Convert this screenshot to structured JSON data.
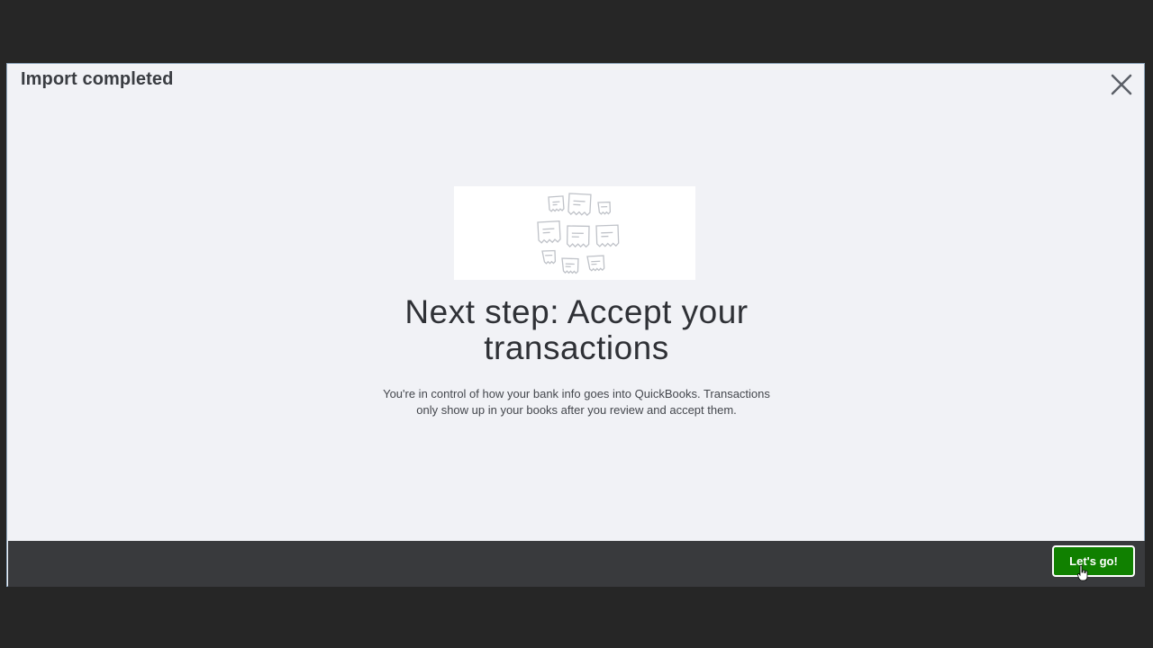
{
  "dialog": {
    "title": "Import completed",
    "close_icon": "close-icon"
  },
  "main": {
    "illustration_icon": "receipts-illustration",
    "headline_line1": "Next step: Accept your",
    "headline_line2": "transactions",
    "description_line1": "You're in control of how your bank info goes into QuickBooks. Transactions",
    "description_line2": "only show up in your books after you review and accept them."
  },
  "footer": {
    "primary_button_label": "Let's go!"
  },
  "colors": {
    "primary_green": "#108000",
    "footer_bg": "#393a3d",
    "dialog_bg": "#f1f2f6"
  }
}
